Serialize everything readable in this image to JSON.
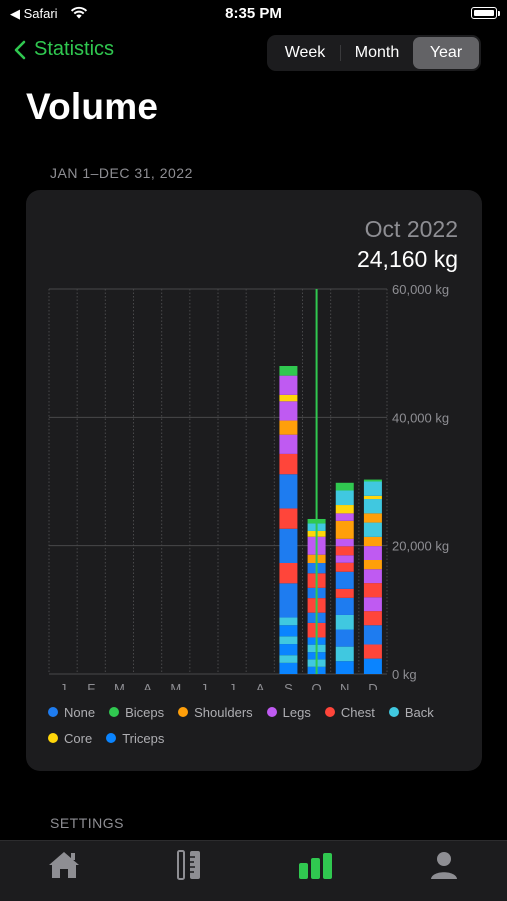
{
  "status_bar": {
    "back_app": "Safari",
    "time": "8:35 PM"
  },
  "nav": {
    "back_label": "Statistics"
  },
  "segmented": {
    "options": [
      "Week",
      "Month",
      "Year"
    ],
    "selected": "Year"
  },
  "page": {
    "title": "Volume",
    "date_range": "JAN 1–DEC 31, 2022"
  },
  "selection": {
    "period": "Oct 2022",
    "value": "24,160 kg"
  },
  "settings_header": "SETTINGS",
  "colors": {
    "None": "#1e7cf0",
    "Biceps": "#30c850",
    "Shoulders": "#ff9f0a",
    "Legs": "#bf5af2",
    "Chest": "#ff453a",
    "Back": "#40c8e0",
    "Core": "#ffd60a",
    "Triceps": "#0a84ff",
    "accent": "#30c850"
  },
  "tabs": [
    "home-icon",
    "ruler-icon",
    "chart-icon",
    "profile-icon"
  ],
  "chart_data": {
    "type": "bar",
    "stacked": true,
    "categories": [
      "J",
      "F",
      "M",
      "A",
      "M",
      "J",
      "J",
      "A",
      "S",
      "O",
      "N",
      "D"
    ],
    "y_unit": "kg",
    "ylim": [
      0,
      60000
    ],
    "y_ticks": [
      "0 kg",
      "20,000 kg",
      "40,000 kg",
      "60,000 kg"
    ],
    "selected_category_index": 9,
    "series": [
      {
        "name": "None",
        "values": [
          0,
          0,
          0,
          0,
          0,
          0,
          0,
          0,
          16000,
          4800,
          8000,
          3000
        ]
      },
      {
        "name": "Biceps",
        "values": [
          0,
          0,
          0,
          0,
          0,
          0,
          0,
          0,
          1500,
          700,
          1200,
          300
        ]
      },
      {
        "name": "Shoulders",
        "values": [
          0,
          0,
          0,
          0,
          0,
          0,
          0,
          0,
          2200,
          1300,
          2800,
          4300
        ]
      },
      {
        "name": "Legs",
        "values": [
          0,
          0,
          0,
          0,
          0,
          0,
          0,
          0,
          9000,
          2800,
          3500,
          6500
        ]
      },
      {
        "name": "Chest",
        "values": [
          0,
          0,
          0,
          0,
          0,
          0,
          0,
          0,
          9500,
          6800,
          4200,
          6600
        ]
      },
      {
        "name": "Back",
        "values": [
          0,
          0,
          0,
          0,
          0,
          0,
          0,
          0,
          3600,
          3500,
          6800,
          6700
        ]
      },
      {
        "name": "Core",
        "values": [
          0,
          0,
          0,
          0,
          0,
          0,
          0,
          0,
          1000,
          900,
          1300,
          500
        ]
      },
      {
        "name": "Triceps",
        "values": [
          0,
          0,
          0,
          0,
          0,
          0,
          0,
          0,
          5200,
          3360,
          2000,
          2400
        ]
      }
    ],
    "legend": [
      "None",
      "Biceps",
      "Shoulders",
      "Legs",
      "Chest",
      "Back",
      "Core",
      "Triceps"
    ],
    "legend_position": "bottom",
    "grid": true
  }
}
